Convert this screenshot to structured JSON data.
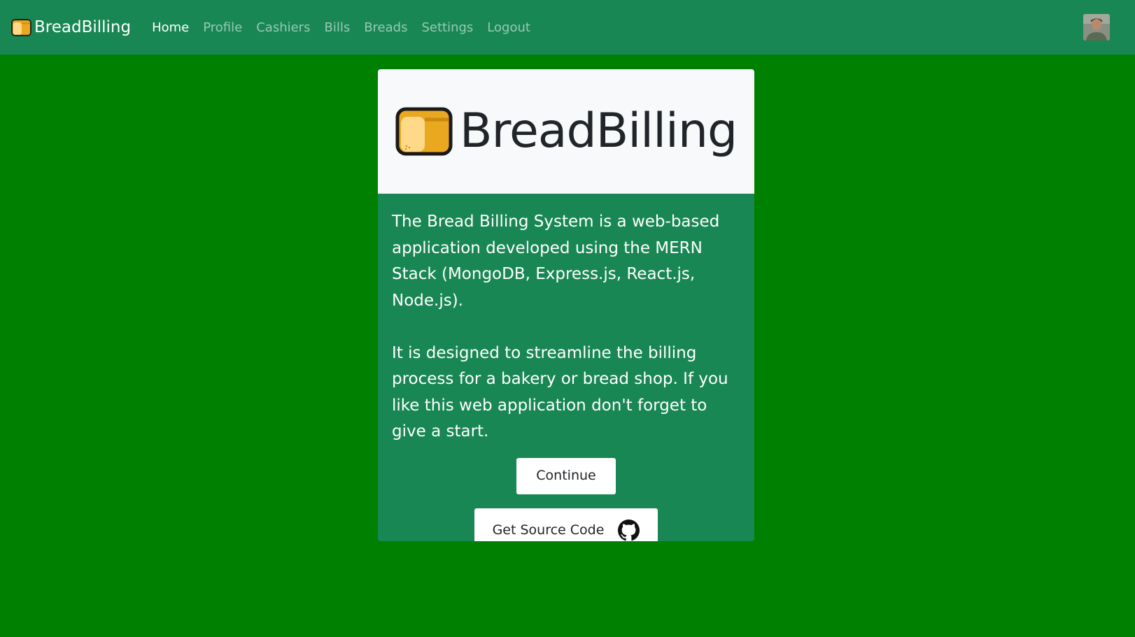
{
  "navbar": {
    "brand": "BreadBilling",
    "brand_icon": "bread-icon",
    "links": [
      {
        "label": "Home",
        "active": true
      },
      {
        "label": "Profile",
        "active": false
      },
      {
        "label": "Cashiers",
        "active": false
      },
      {
        "label": "Bills",
        "active": false
      },
      {
        "label": "Breads",
        "active": false
      },
      {
        "label": "Settings",
        "active": false
      },
      {
        "label": "Logout",
        "active": false
      }
    ],
    "avatar": "user-avatar"
  },
  "card": {
    "logo_text": "BreadBilling",
    "logo_icon": "bread-icon",
    "paragraph1": "The Bread Billing System is a web-based application developed using the MERN Stack (MongoDB, Express.js, React.js, Node.js).",
    "paragraph2": "It is designed to streamline the billing process for a bakery or bread shop. If you like this web application don't forget to give a start.",
    "continue_label": "Continue",
    "source_label": "Get Source Code",
    "source_icon": "github-icon"
  },
  "colors": {
    "page_background": "#008000",
    "navbar_background": "#198754",
    "card_background": "#198754",
    "card_header_background": "#f8f9fa",
    "bread_crust": "#e9a81f",
    "bread_light": "#ffd98a"
  }
}
